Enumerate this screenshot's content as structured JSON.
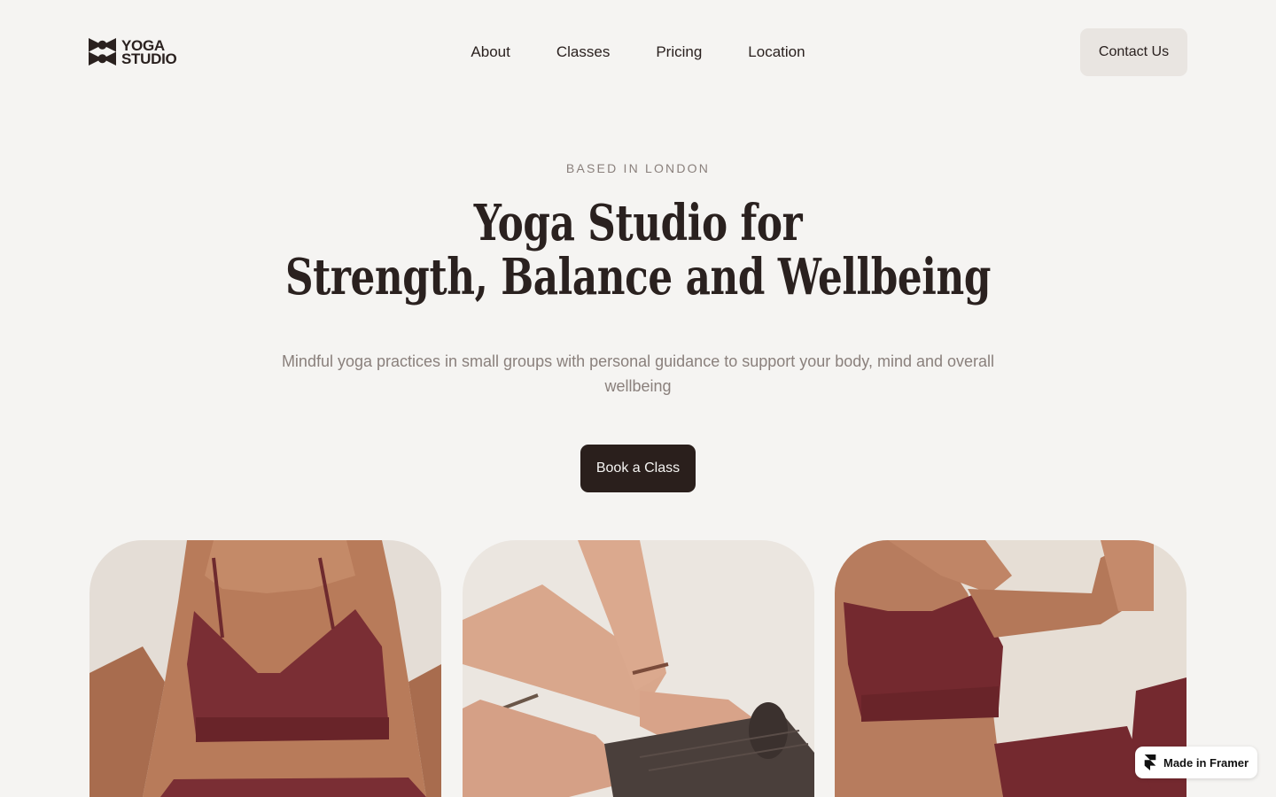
{
  "brand": {
    "line1": "YOGA",
    "line2": "STUDIO",
    "logo_icon": "yoga-studio-logo-mark"
  },
  "nav": {
    "items": [
      {
        "label": "About"
      },
      {
        "label": "Classes"
      },
      {
        "label": "Pricing"
      },
      {
        "label": "Location"
      }
    ]
  },
  "header": {
    "contact_label": "Contact Us"
  },
  "hero": {
    "eyebrow": "BASED IN LONDON",
    "title_line1": "Yoga Studio for",
    "title_line2": "Strength, Balance and Wellbeing",
    "subtitle": "Mindful yoga practices in small groups with personal guidance to support your body, mind and overall wellbeing",
    "cta_label": "Book a Class"
  },
  "gallery": {
    "images": [
      {
        "name": "woman-in-burgundy-sports-bra"
      },
      {
        "name": "hands-rolling-yoga-mat"
      },
      {
        "name": "woman-stretching-pose"
      }
    ]
  },
  "badge": {
    "label": "Made in Framer",
    "icon": "framer-icon"
  },
  "colors": {
    "background": "#f5f4f2",
    "text": "#2a211f",
    "muted": "#8a807c",
    "primary_button": "#2a1f1c",
    "secondary_button": "#e9e5e1",
    "burgundy": "#6e2a2e"
  }
}
